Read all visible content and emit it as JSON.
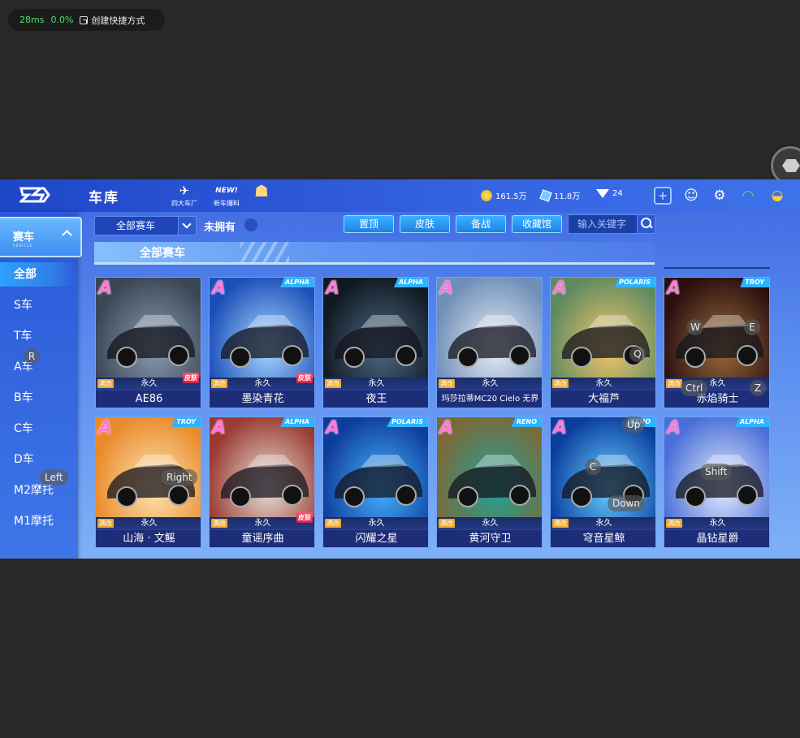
{
  "overlay": {
    "latency": "28ms",
    "loss": "0.0%",
    "shortcut_label": "创建快捷方式"
  },
  "header": {
    "title": "车库",
    "nav": [
      {
        "label": "四大车厂",
        "icon": "car-factory-icon"
      },
      {
        "label": "新车爆料",
        "icon": "new-badge-icon"
      },
      {
        "label": "",
        "icon": "gift-icon"
      }
    ],
    "resources": {
      "coins": "161.5万",
      "coupons": "11.8万",
      "diamonds": "24"
    },
    "icons": [
      "add-icon",
      "friends-icon",
      "settings-icon",
      "wifi-icon",
      "battery-icon"
    ]
  },
  "sidebar": {
    "category": {
      "label": "赛车",
      "sub": "VEHICLE"
    },
    "items": [
      "全部",
      "S车",
      "T车",
      "A车",
      "B车",
      "C车",
      "D车",
      "M2摩托",
      "M1摩托"
    ],
    "active": "全部"
  },
  "toolbar": {
    "filter": "全部赛车",
    "unowned_label": "未拥有",
    "buttons": [
      "置顶",
      "皮肤",
      "备战",
      "收藏馆"
    ],
    "search_placeholder": "输入关键字"
  },
  "section_title": "全部赛车",
  "cards": [
    {
      "name": "AE86",
      "rank": "A",
      "brand": "",
      "duration": "永久",
      "mod": "满改",
      "skin": "皮肤",
      "theme": "#3a4656,#8a9db0"
    },
    {
      "name": "墨染青花",
      "rank": "A",
      "brand": "ALPHA",
      "duration": "永久",
      "mod": "满改",
      "skin": "皮肤",
      "theme": "#1b4fb8,#a9d8ff"
    },
    {
      "name": "夜王",
      "rank": "A",
      "brand": "ALPHA",
      "duration": "永久",
      "mod": "满改",
      "skin": "",
      "theme": "#101820,#4d6a86"
    },
    {
      "name": "玛莎拉蒂MC20 Cielo 无界",
      "rank": "A",
      "brand": "",
      "duration": "永久",
      "mod": "满改",
      "skin": "",
      "theme": "#6f8fb8,#e9eef5"
    },
    {
      "name": "大福芦",
      "rank": "A",
      "brand": "POLARIS",
      "duration": "永久",
      "mod": "满改",
      "skin": "",
      "theme": "#5f8a60,#f2c66b"
    },
    {
      "name": "赤焰骑士",
      "rank": "A",
      "brand": "TROY",
      "duration": "永久",
      "mod": "满改",
      "skin": "",
      "theme": "#2b1010,#9a6b3a"
    },
    {
      "name": "山海 · 文鳐",
      "rank": "A",
      "brand": "TROY",
      "duration": "永久",
      "mod": "满改",
      "skin": "",
      "theme": "#e98a2a,#fde6b5"
    },
    {
      "name": "童谣序曲",
      "rank": "A",
      "brand": "ALPHA",
      "duration": "永久",
      "mod": "满改",
      "skin": "皮肤",
      "theme": "#9a3a30,#e7e1d8"
    },
    {
      "name": "闪耀之星",
      "rank": "A",
      "brand": "POLARIS",
      "duration": "永久",
      "mod": "满改",
      "skin": "",
      "theme": "#0e3c9a,#46b3ff"
    },
    {
      "name": "黄河守卫",
      "rank": "A",
      "brand": "RENO",
      "duration": "永久",
      "mod": "满改",
      "skin": "",
      "theme": "#7a6a3a,#1fa39a"
    },
    {
      "name": "穹音星鲸",
      "rank": "A",
      "brand": "RENO",
      "duration": "永久",
      "mod": "满改",
      "skin": "",
      "theme": "#0a3d9e,#6ad0ff"
    },
    {
      "name": "晶钻星爵",
      "rank": "A",
      "brand": "ALPHA",
      "duration": "永久",
      "mod": "满改",
      "skin": "",
      "theme": "#4a6fd8,#e4ecff"
    }
  ],
  "key_hints": [
    "R",
    "Left",
    "Right",
    "W",
    "E",
    "Q",
    "Ctrl",
    "Z",
    "Up",
    "C",
    "Down",
    "Shift"
  ]
}
